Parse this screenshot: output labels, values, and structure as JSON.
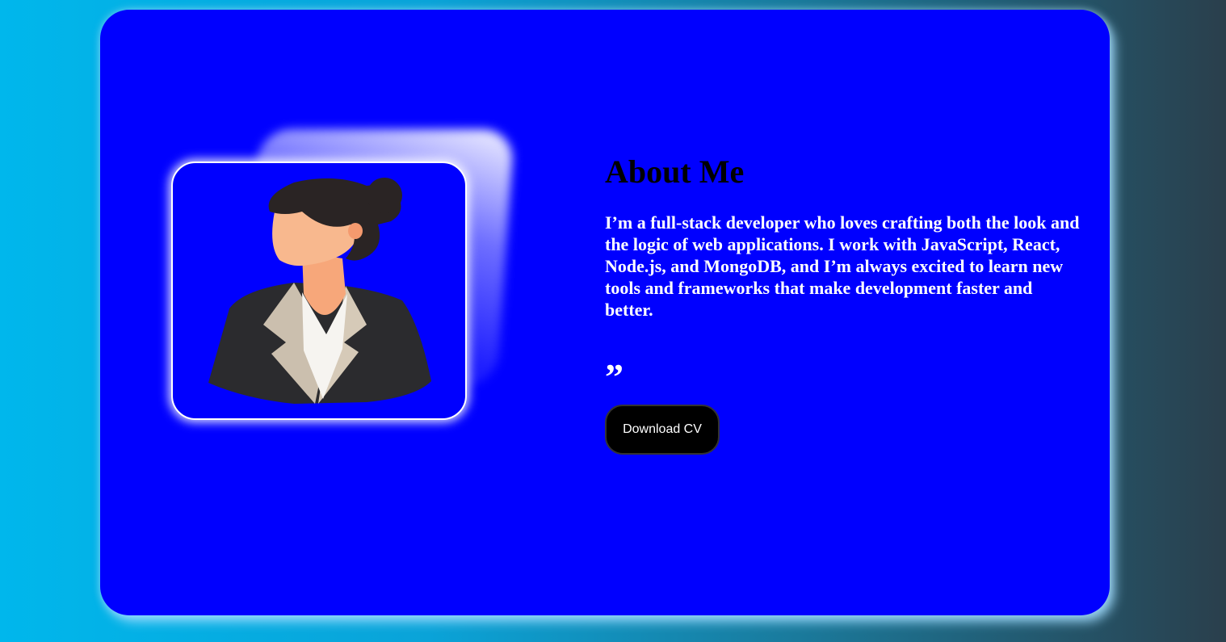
{
  "about": {
    "title": "About Me",
    "bio": "I’m a full-stack developer who loves crafting both the look and the logic of web applications. I work with JavaScript, React, Node.js, and MongoDB, and I’m always excited to learn new tools and frameworks that make development faster and better.",
    "quote_mark": "”",
    "download_button_label": "Download CV"
  },
  "colors": {
    "card_background": "#0000ff",
    "title_text": "#000000",
    "bio_text": "#ffffff",
    "button_background": "#000000",
    "button_text": "#ffffff",
    "page_gradient_start": "#00b7ec",
    "page_gradient_end": "#2a3f4c"
  },
  "images": {
    "profile": "profile-illustration-woman-in-blazer"
  }
}
